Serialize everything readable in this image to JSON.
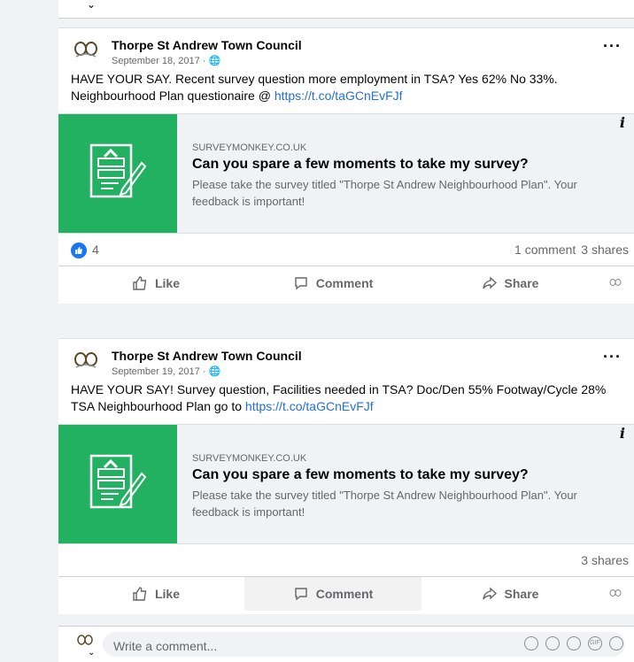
{
  "posts": [
    {
      "page_name": "Thorpe St Andrew Town Council",
      "date": "September 18, 2017 ·",
      "text": "HAVE YOUR SAY. Recent survey question more employment in TSA? Yes 62% No 33%. Neighbourhood Plan questionaire @ ",
      "link_text": "https://t.co/taGCnEvFJf",
      "card": {
        "domain": "SURVEYMONKEY.CO.UK",
        "title": "Can you spare a few moments to take my survey?",
        "description": "Please take the survey titled \"Thorpe St Andrew Neighbourhood Plan\". Your feedback is important!"
      },
      "like_count": "4",
      "comments": "1 comment",
      "shares": "3 shares",
      "actions": {
        "like": "Like",
        "comment": "Comment",
        "share": "Share"
      }
    },
    {
      "page_name": "Thorpe St Andrew Town Council",
      "date": "September 19, 2017 ·",
      "text": "HAVE YOUR SAY! Survey question, Facilities needed in TSA? Doc/Den 55% Footway/Cycle 28% TSA Neighbourhood Plan go to ",
      "link_text": "https://t.co/taGCnEvFJf",
      "card": {
        "domain": "SURVEYMONKEY.CO.UK",
        "title": "Can you spare a few moments to take my survey?",
        "description": "Please take the survey titled \"Thorpe St Andrew Neighbourhood Plan\". Your feedback is important!"
      },
      "shares": "3 shares",
      "actions": {
        "like": "Like",
        "comment": "Comment",
        "share": "Share"
      }
    }
  ],
  "comment_box": {
    "placeholder": "Write a comment..."
  },
  "colors": {
    "thumb_green": "#21b160",
    "link_blue": "#216fdb",
    "like_blue": "#1877f2"
  }
}
